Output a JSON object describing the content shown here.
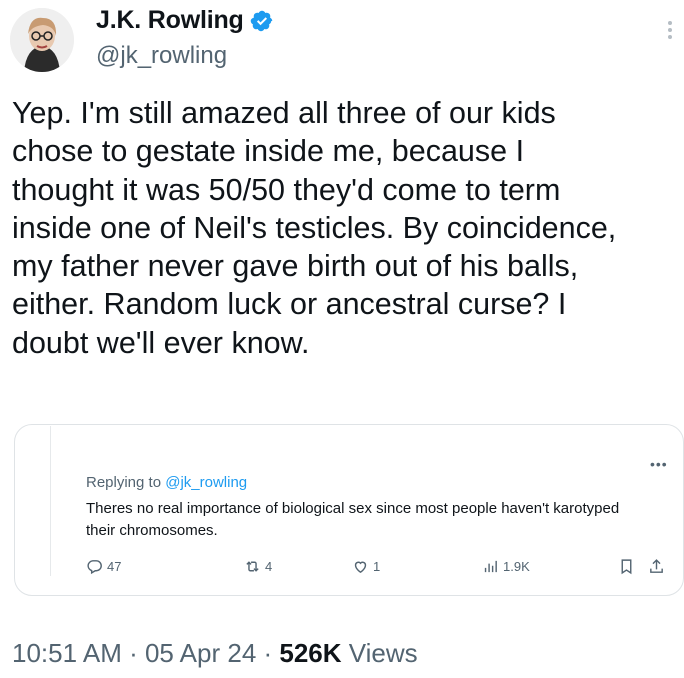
{
  "author": {
    "name": "J.K. Rowling",
    "handle": "@jk_rowling",
    "verified": true
  },
  "tweet": {
    "text": "Yep. I'm still amazed all three of our kids\nchose to gestate inside me, because I\nthought it was 50/50 they'd come to term\ninside one of Neil's testicles. By coincidence,\nmy father never gave birth out of his balls,\neither. Random luck or ancestral curse? I\ndoubt we'll ever know."
  },
  "quoted": {
    "replying_prefix": "Replying to ",
    "replying_to": "@jk_rowling",
    "text": "Theres no real importance of biological sex since most people haven't karotyped their chromosomes.",
    "actions": {
      "replies": "47",
      "retweets": "4",
      "likes": "1",
      "views": "1.9K"
    }
  },
  "meta": {
    "time": "10:51 AM",
    "date": "05 Apr 24",
    "views": "526K",
    "views_label": "Views",
    "separator": " · "
  },
  "colors": {
    "accent": "#1d9bf0",
    "secondary_text": "#536471",
    "primary_text": "#0f1419"
  }
}
